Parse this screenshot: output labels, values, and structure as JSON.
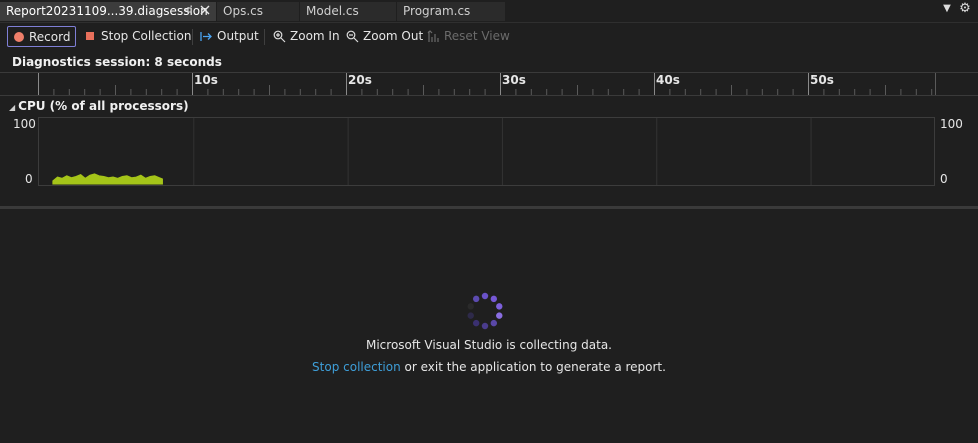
{
  "tabs": [
    {
      "label": "Report20231109...39.diagsession",
      "active": true
    },
    {
      "label": "Ops.cs",
      "active": false
    },
    {
      "label": "Model.cs",
      "active": false
    },
    {
      "label": "Program.cs",
      "active": false
    }
  ],
  "tab_icons": {
    "pin": "pin-icon",
    "close": "close-icon",
    "dropdown": "chevron-down-icon",
    "settings": "gear-icon"
  },
  "toolbar": {
    "record_label": "Record",
    "stop_label": "Stop Collection",
    "output_label": "Output",
    "zoom_in_label": "Zoom In",
    "zoom_out_label": "Zoom Out",
    "reset_view_label": "Reset View"
  },
  "session_label": "Diagnostics session: 8 seconds",
  "ruler": {
    "ticks": [
      "10s",
      "20s",
      "30s",
      "40s",
      "50s"
    ]
  },
  "cpu": {
    "title": "CPU (% of all processors)",
    "y_max": "100",
    "y_min": "0"
  },
  "chart_data": {
    "type": "area",
    "title": "CPU (% of all processors)",
    "xlabel": "",
    "ylabel": "",
    "ylim": [
      0,
      100
    ],
    "x": [
      0.9,
      1.2,
      1.5,
      1.8,
      2.1,
      2.4,
      2.7,
      3.0,
      3.3,
      3.6,
      3.9,
      4.2,
      4.5,
      4.8,
      5.1,
      5.4,
      5.7,
      6.0,
      6.3,
      6.6,
      6.9,
      7.2,
      7.5,
      7.8,
      8.0
    ],
    "series": [
      {
        "values": [
          5,
          11,
          9,
          13,
          10,
          12,
          15,
          9,
          14,
          16,
          13,
          12,
          10,
          11,
          9,
          12,
          13,
          10,
          11,
          14,
          9,
          12,
          13,
          10,
          8
        ]
      }
    ],
    "xlim": [
      0,
      58
    ]
  },
  "colors": {
    "cpu": "#a5c419",
    "accent": "#7f7fd6",
    "link": "#3e9ed8",
    "record": "#ef7f6a"
  },
  "status": {
    "collecting": "Microsoft Visual Studio is collecting data.",
    "stop_link": "Stop collection",
    "stop_suffix": "or exit the application to generate a report."
  }
}
